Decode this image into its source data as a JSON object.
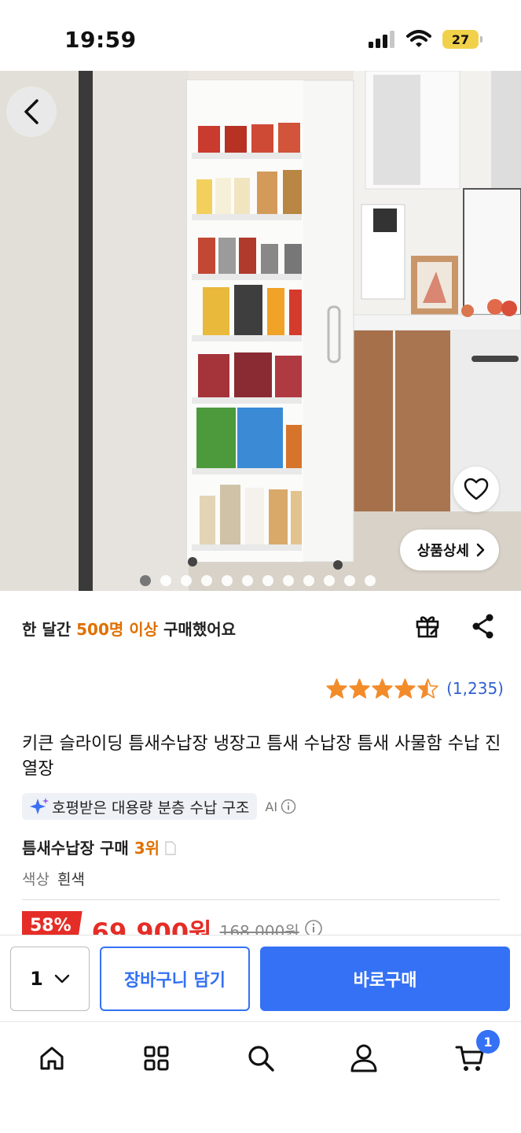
{
  "status_bar": {
    "time": "19:59",
    "battery": "27",
    "icons": [
      "cellular-signal-icon",
      "wifi-icon",
      "battery-icon"
    ]
  },
  "hero": {
    "image_alt": "Slim white rolling pantry cabinet between refrigerator and kitchen counter",
    "back_icon": "chevron-left-icon",
    "wishlist_icon": "heart-icon",
    "detail_button_label": "상품상세",
    "detail_button_icon": "chevron-right-icon",
    "slide_count": 12,
    "active_slide": 1
  },
  "buyers": {
    "prefix": "한 달간 ",
    "highlight": "500명 이상",
    "suffix": " 구매했어요",
    "highlight_color": "#e07000"
  },
  "header_actions": [
    "gift-icon",
    "share-icon"
  ],
  "rating": {
    "stars": 4.5,
    "count": "(1,235)",
    "star_color": "#f28c2b"
  },
  "product": {
    "title": "키큰 슬라이딩 틈새수납장 냉장고 틈새 수납장 틈새 사물함 수납 진열장",
    "ai_summary": "호평받은 대용량 분층 수납 구조",
    "ai_label": "AI",
    "rank_prefix": "틈새수납장 구매 ",
    "rank_value": "3위",
    "color_label": "색상",
    "color_value": "흰색"
  },
  "price": {
    "discount": "58%",
    "sale_price": "69,900원",
    "original_price": "168,000원",
    "sale_color": "#e52d27"
  },
  "action_bar": {
    "quantity": "1",
    "cart_button": "장바구니 담기",
    "buy_button": "바로구매",
    "accent_color": "#3471f4"
  },
  "bottom_nav": {
    "items": [
      "home-icon",
      "category-grid-icon",
      "search-icon",
      "user-icon",
      "cart-icon"
    ],
    "cart_badge": "1"
  }
}
